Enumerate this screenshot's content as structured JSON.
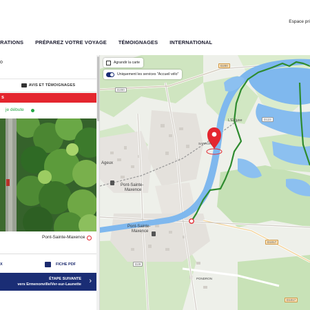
{
  "header": {
    "espace": "Espace pri",
    "nav": [
      "IRATIONS",
      "PRÉPAREZ VOTRE VOYAGE",
      "TÉMOIGNAGES",
      "INTERNATIONAL"
    ]
  },
  "panel": {
    "title_fragment": "o",
    "avis_label": "AVIS ET TÉMOIGNAGES",
    "red_fragment": "s",
    "debute_label": "je débute",
    "photo_location": "Pont-Sainte-Maxence",
    "export_fragment": "X",
    "fiche_label": "FICHE PDF",
    "next_label": "ÉTAPE SUIVANTE",
    "next_destination": "vers Ermenonville/Ver-sur-Launette"
  },
  "map": {
    "enlarge_label": "Agrandir la carte",
    "toggle_label": "Uniquement les services \"Accueil vélo\"",
    "places": {
      "ageux": "Ageux",
      "psm_upper_1": "Pont-Sainte-",
      "psm_upper_2": "Maxence",
      "psm_lower_1": "Pont-Sainte-",
      "psm_lower_2": "Maxence",
      "sarron": "SARRON",
      "lecluse": "L'Écluse",
      "pondron": "PONDRON"
    },
    "roads": [
      "D200",
      "D200",
      "D29",
      "D1017",
      "D123",
      "D1017"
    ],
    "colors": {
      "route": "#2e8b2f",
      "river": "#5aa3e6",
      "marker": "#e4262f",
      "primary": "#1a2d75"
    }
  }
}
